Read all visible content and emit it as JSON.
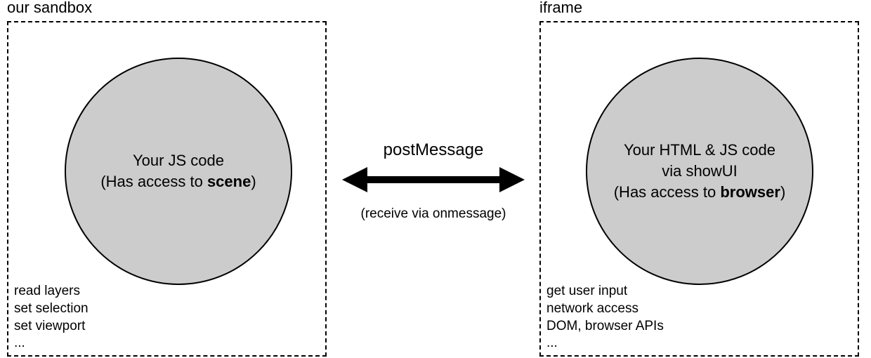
{
  "left": {
    "title": "our sandbox",
    "circle_line1": "Your JS code",
    "circle_line2_pre": "(Has access to ",
    "circle_line2_bold": "scene",
    "circle_line2_post": ")",
    "capabilities": [
      "read layers",
      "set selection",
      "set viewport",
      "..."
    ]
  },
  "right": {
    "title": "iframe",
    "circle_line1": "Your  HTML & JS code",
    "circle_line2": "via showUI",
    "circle_line3_pre": "(Has access to ",
    "circle_line3_bold": "browser",
    "circle_line3_post": ")",
    "capabilities": [
      "get user input",
      "network access",
      "DOM, browser APIs",
      "..."
    ]
  },
  "middle": {
    "top": "postMessage",
    "sub": "(receive via onmessage)"
  }
}
